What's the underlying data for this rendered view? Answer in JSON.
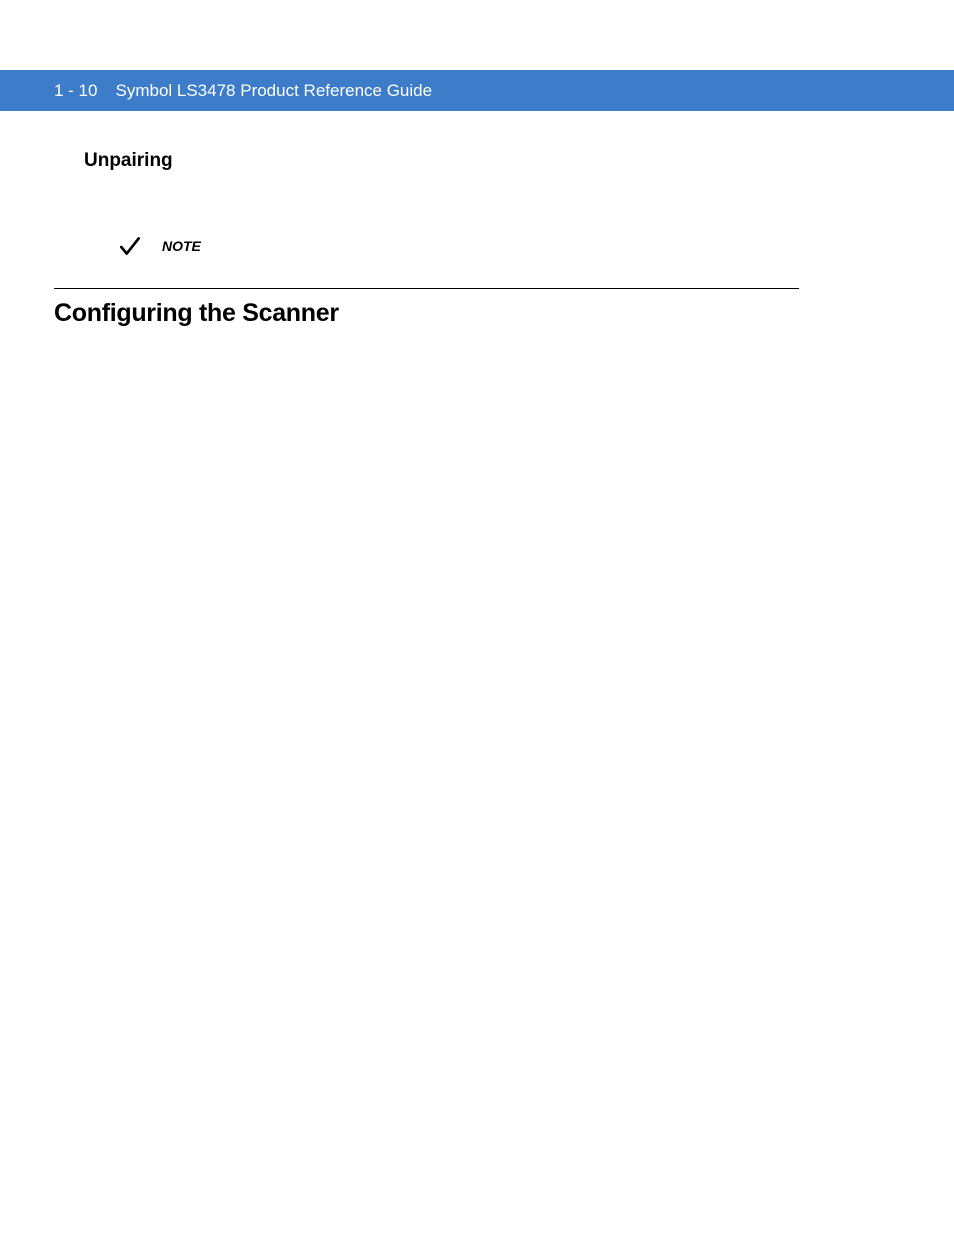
{
  "header": {
    "page_number": "1 - 10",
    "title": "Symbol LS3478 Product Reference Guide"
  },
  "sections": {
    "unpairing": {
      "heading": "Unpairing"
    },
    "note": {
      "label": "NOTE"
    },
    "configuring": {
      "heading": "Configuring the Scanner"
    }
  }
}
